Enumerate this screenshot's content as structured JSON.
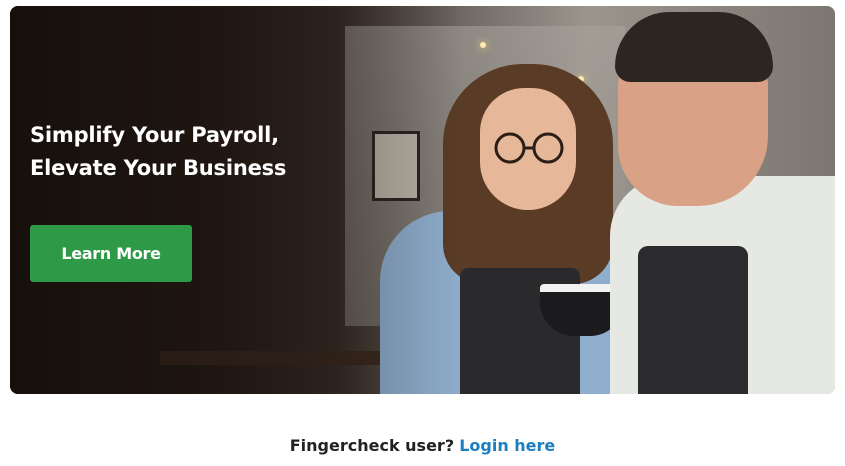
{
  "hero": {
    "headline_line1": "Simplify Your Payroll,",
    "headline_line2": "Elevate Your Business",
    "cta_label": "Learn More",
    "cta_color": "#2e9a47"
  },
  "footer": {
    "question": "Fingercheck user?",
    "login_link": "Login here",
    "link_color": "#1c7fc1"
  }
}
